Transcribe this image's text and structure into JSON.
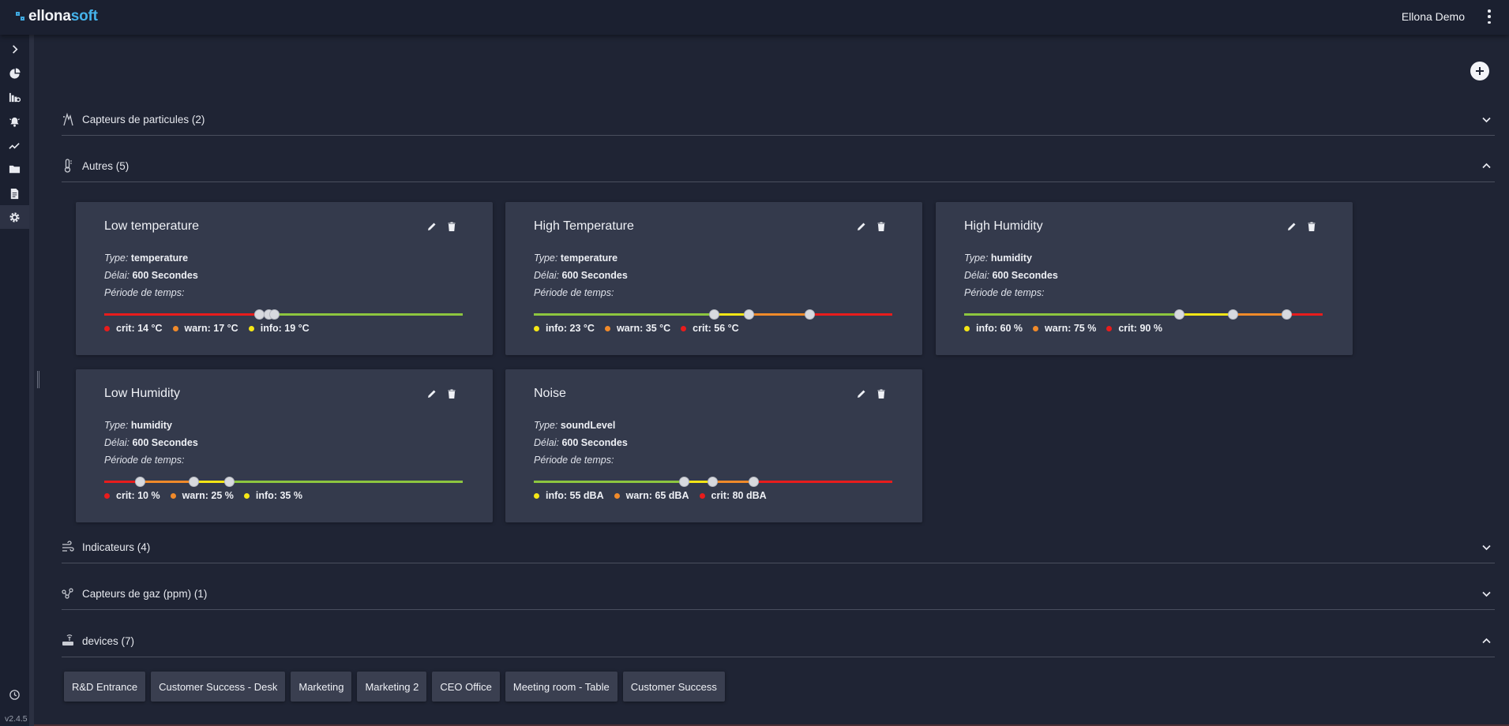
{
  "header": {
    "logo_prefix": "ellona",
    "logo_suffix": "soft",
    "user_name": "Ellona Demo"
  },
  "sidebar": {
    "items": [
      {
        "icon": "chevron-right-icon"
      },
      {
        "icon": "pie-chart-icon"
      },
      {
        "icon": "building-settings-icon"
      },
      {
        "icon": "alarm-bell-icon"
      },
      {
        "icon": "trend-line-icon"
      },
      {
        "icon": "folder-icon"
      },
      {
        "icon": "document-icon"
      },
      {
        "icon": "gear-icon",
        "active": true
      }
    ],
    "version": "v2.4.5"
  },
  "sections": {
    "particles": {
      "title": "Capteurs de particules (2)",
      "icon": "particle-sensor-icon",
      "expanded": false
    },
    "autres": {
      "title": "Autres (5)",
      "icon": "thermometer-icon",
      "expanded": true
    },
    "indicateurs": {
      "title": "Indicateurs (4)",
      "icon": "wind-icon",
      "expanded": false
    },
    "gaz": {
      "title": "Capteurs de gaz (ppm) (1)",
      "icon": "molecule-icon",
      "expanded": false
    },
    "devices": {
      "title": "devices (7)",
      "icon": "router-icon",
      "expanded": true
    }
  },
  "labels": {
    "type": "Type:",
    "delay": "Délai:",
    "period": "Période de temps:"
  },
  "colors": {
    "green": "#8dc63f",
    "yellow": "#f5e616",
    "orange": "#f08a2a",
    "red": "#e81c1c",
    "card_bg": "#343a4c",
    "page_bg": "#1f2434"
  },
  "cards": [
    {
      "title": "Low temperature",
      "type": "temperature",
      "delay": "600 Secondes",
      "legend": [
        {
          "label": "crit: 14 °C",
          "color": "#e81c1c"
        },
        {
          "label": "warn: 17 °C",
          "color": "#f08a2a"
        },
        {
          "label": "info: 19 °C",
          "color": "#f5e616"
        }
      ]
    },
    {
      "title": "High Temperature",
      "type": "temperature",
      "delay": "600 Secondes",
      "legend": [
        {
          "label": "info: 23 °C",
          "color": "#f5e616"
        },
        {
          "label": "warn: 35 °C",
          "color": "#f08a2a"
        },
        {
          "label": "crit: 56 °C",
          "color": "#e81c1c"
        }
      ]
    },
    {
      "title": "High Humidity",
      "type": "humidity",
      "delay": "600 Secondes",
      "legend": [
        {
          "label": "info: 60 %",
          "color": "#f5e616"
        },
        {
          "label": "warn: 75 %",
          "color": "#f08a2a"
        },
        {
          "label": "crit: 90 %",
          "color": "#e81c1c"
        }
      ]
    },
    {
      "title": "Low Humidity",
      "type": "humidity",
      "delay": "600 Secondes",
      "legend": [
        {
          "label": "crit: 10 %",
          "color": "#e81c1c"
        },
        {
          "label": "warn: 25 %",
          "color": "#f08a2a"
        },
        {
          "label": "info: 35 %",
          "color": "#f5e616"
        }
      ]
    },
    {
      "title": "Noise",
      "type": "soundLevel",
      "delay": "600 Secondes",
      "legend": [
        {
          "label": "info: 55 dBA",
          "color": "#f5e616"
        },
        {
          "label": "warn: 65 dBA",
          "color": "#f08a2a"
        },
        {
          "label": "crit: 80 dBA",
          "color": "#e81c1c"
        }
      ]
    }
  ],
  "devices": [
    "R&D Entrance",
    "Customer Success - Desk",
    "Marketing",
    "Marketing 2",
    "CEO Office",
    "Meeting room - Table",
    "Customer Success"
  ]
}
